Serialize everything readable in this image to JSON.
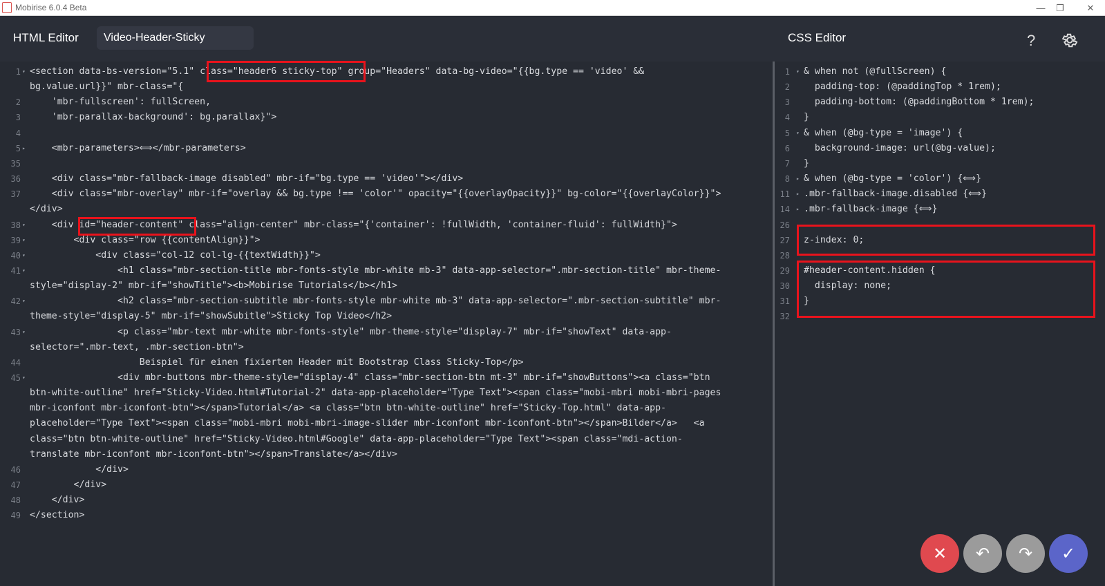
{
  "window": {
    "title": "Mobirise 6.0.4 Beta"
  },
  "header": {
    "html_editor_label": "HTML Editor",
    "page_name": "Video-Header-Sticky",
    "css_editor_label": "CSS Editor",
    "help_label": "?"
  },
  "html_lines": [
    {
      "num": "1",
      "fold": "▾",
      "text": "<section data-bs-version=\"5.1\" class=\"header6 sticky-top\" group=\"Headers\" data-bg-video=\"{{bg.type == 'video' &&"
    },
    {
      "num": "",
      "fold": "",
      "text": "bg.value.url}}\" mbr-class=\"{"
    },
    {
      "num": "2",
      "fold": "",
      "text": "    'mbr-fullscreen': fullScreen,"
    },
    {
      "num": "3",
      "fold": "",
      "text": "    'mbr-parallax-background': bg.parallax}\">"
    },
    {
      "num": "4",
      "fold": "",
      "text": ""
    },
    {
      "num": "5",
      "fold": "▸",
      "text": "    <mbr-parameters>⟺</mbr-parameters>"
    },
    {
      "num": "35",
      "fold": "",
      "text": ""
    },
    {
      "num": "36",
      "fold": "",
      "text": "    <div class=\"mbr-fallback-image disabled\" mbr-if=\"bg.type == 'video'\"></div>"
    },
    {
      "num": "37",
      "fold": "",
      "text": "    <div class=\"mbr-overlay\" mbr-if=\"overlay && bg.type !== 'color'\" opacity=\"{{overlayOpacity}}\" bg-color=\"{{overlayColor}}\">"
    },
    {
      "num": "",
      "fold": "",
      "text": "</div>"
    },
    {
      "num": "38",
      "fold": "▾",
      "text": "    <div id=\"header-content\" class=\"align-center\" mbr-class=\"{'container': !fullWidth, 'container-fluid': fullWidth}\">"
    },
    {
      "num": "39",
      "fold": "▾",
      "text": "        <div class=\"row {{contentAlign}}\">"
    },
    {
      "num": "40",
      "fold": "▾",
      "text": "            <div class=\"col-12 col-lg-{{textWidth}}\">"
    },
    {
      "num": "41",
      "fold": "▾",
      "text": "                <h1 class=\"mbr-section-title mbr-fonts-style mbr-white mb-3\" data-app-selector=\".mbr-section-title\" mbr-theme-"
    },
    {
      "num": "",
      "fold": "",
      "text": "style=\"display-2\" mbr-if=\"showTitle\"><b>Mobirise Tutorials</b></h1>"
    },
    {
      "num": "42",
      "fold": "▾",
      "text": "                <h2 class=\"mbr-section-subtitle mbr-fonts-style mbr-white mb-3\" data-app-selector=\".mbr-section-subtitle\" mbr-"
    },
    {
      "num": "",
      "fold": "",
      "text": "theme-style=\"display-5\" mbr-if=\"showSubitle\">Sticky Top Video</h2>"
    },
    {
      "num": "43",
      "fold": "▾",
      "text": "                <p class=\"mbr-text mbr-white mbr-fonts-style\" mbr-theme-style=\"display-7\" mbr-if=\"showText\" data-app-"
    },
    {
      "num": "",
      "fold": "",
      "text": "selector=\".mbr-text, .mbr-section-btn\">"
    },
    {
      "num": "44",
      "fold": "",
      "text": "                    Beispiel für einen fixierten Header mit Bootstrap Class Sticky-Top</p>"
    },
    {
      "num": "45",
      "fold": "▾",
      "text": "                <div mbr-buttons mbr-theme-style=\"display-4\" class=\"mbr-section-btn mt-3\" mbr-if=\"showButtons\"><a class=\"btn"
    },
    {
      "num": "",
      "fold": "",
      "text": "btn-white-outline\" href=\"Sticky-Video.html#Tutorial-2\" data-app-placeholder=\"Type Text\"><span class=\"mobi-mbri mobi-mbri-pages"
    },
    {
      "num": "",
      "fold": "",
      "text": "mbr-iconfont mbr-iconfont-btn\"></span>Tutorial</a> <a class=\"btn btn-white-outline\" href=\"Sticky-Top.html\" data-app-"
    },
    {
      "num": "",
      "fold": "",
      "text": "placeholder=\"Type Text\"><span class=\"mobi-mbri mobi-mbri-image-slider mbr-iconfont mbr-iconfont-btn\"></span>Bilder</a>   <a"
    },
    {
      "num": "",
      "fold": "",
      "text": "class=\"btn btn-white-outline\" href=\"Sticky-Video.html#Google\" data-app-placeholder=\"Type Text\"><span class=\"mdi-action-"
    },
    {
      "num": "",
      "fold": "",
      "text": "translate mbr-iconfont mbr-iconfont-btn\"></span>Translate</a></div>"
    },
    {
      "num": "46",
      "fold": "",
      "text": "            </div>"
    },
    {
      "num": "47",
      "fold": "",
      "text": "        </div>"
    },
    {
      "num": "48",
      "fold": "",
      "text": "    </div>"
    },
    {
      "num": "49",
      "fold": "",
      "text": "</section>"
    }
  ],
  "css_lines": [
    {
      "num": "1",
      "fold": "▾",
      "text": "& when not (@fullScreen) {"
    },
    {
      "num": "2",
      "fold": "",
      "text": "  padding-top: (@paddingTop * 1rem);"
    },
    {
      "num": "3",
      "fold": "",
      "text": "  padding-bottom: (@paddingBottom * 1rem);"
    },
    {
      "num": "4",
      "fold": "",
      "text": "}"
    },
    {
      "num": "5",
      "fold": "▾",
      "text": "& when (@bg-type = 'image') {"
    },
    {
      "num": "6",
      "fold": "",
      "text": "  background-image: url(@bg-value);"
    },
    {
      "num": "7",
      "fold": "",
      "text": "}"
    },
    {
      "num": "8",
      "fold": "▸",
      "text": "& when (@bg-type = 'color') {⟺}"
    },
    {
      "num": "11",
      "fold": "▸",
      "text": ".mbr-fallback-image.disabled {⟺}"
    },
    {
      "num": "14",
      "fold": "▸",
      "text": ".mbr-fallback-image {⟺}"
    },
    {
      "num": "26",
      "fold": "",
      "text": ""
    },
    {
      "num": "27",
      "fold": "",
      "text": "z-index: 0;"
    },
    {
      "num": "28",
      "fold": "",
      "text": ""
    },
    {
      "num": "29",
      "fold": "",
      "text": "#header-content.hidden {"
    },
    {
      "num": "30",
      "fold": "",
      "text": "  display: none;"
    },
    {
      "num": "31",
      "fold": "",
      "text": "}"
    },
    {
      "num": "32",
      "fold": "",
      "text": ""
    }
  ],
  "actions": {
    "cancel": "✕",
    "undo": "↶",
    "redo": "↷",
    "save": "✓"
  },
  "colors": {
    "cancel": "#e0494f",
    "undo": "#9b9b9b",
    "redo": "#9b9b9b",
    "save": "#5b65c9",
    "highlight": "#e8131c"
  }
}
